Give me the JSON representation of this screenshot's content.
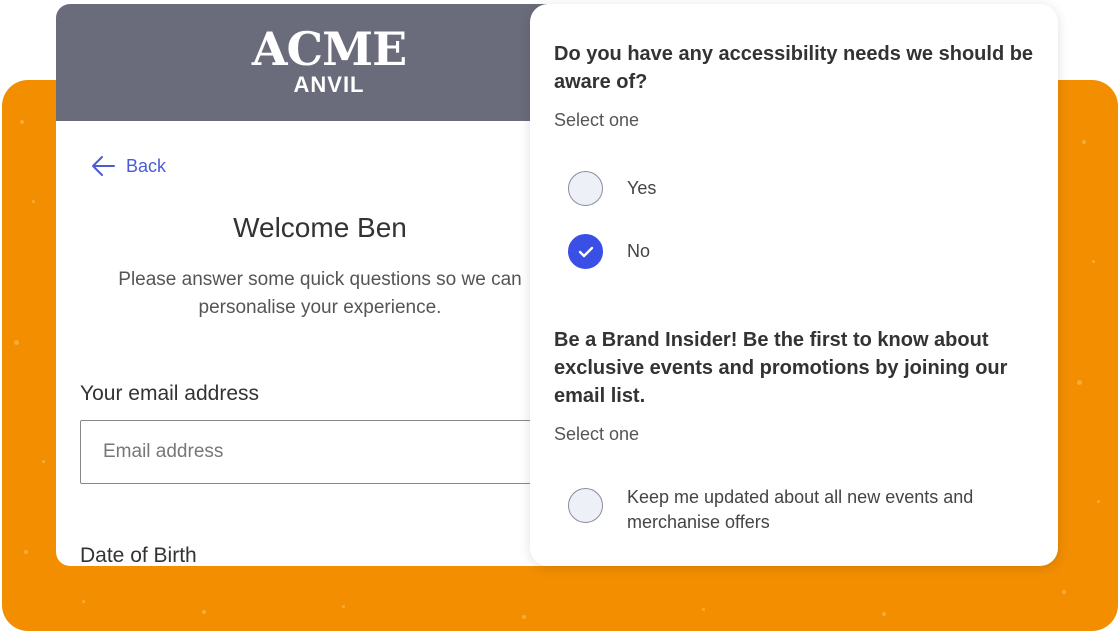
{
  "brand": {
    "logo_line1": "ACME",
    "logo_line2": "ANVIL",
    "header_color": "#6a6c7c",
    "background_accent": "#f28e00"
  },
  "left_form": {
    "back_label": "Back",
    "welcome_title": "Welcome Ben",
    "welcome_text": "Please answer some quick questions so we can personalise your experience.",
    "email_label": "Your email address",
    "email_placeholder": "Email address",
    "email_value": "",
    "dob_label": "Date of Birth"
  },
  "right_form": {
    "accessibility": {
      "question": "Do you have any accessibility needs we should be aware of?",
      "hint": "Select one",
      "options": [
        {
          "label": "Yes",
          "selected": false
        },
        {
          "label": "No",
          "selected": true
        }
      ]
    },
    "brand_insider": {
      "question": "Be a Brand Insider! Be the first to know about exclusive events and promotions by joining our email list.",
      "hint": "Select one",
      "options": [
        {
          "label": "Keep me updated about all new events and merchanise offers",
          "selected": false
        }
      ]
    },
    "accent_color": "#3a4fe6"
  }
}
